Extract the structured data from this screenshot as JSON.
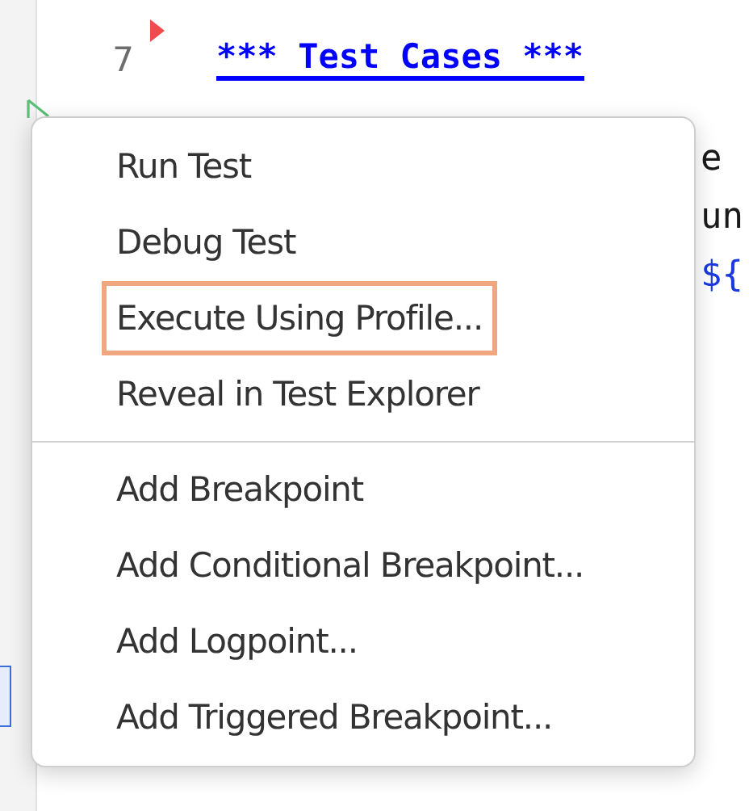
{
  "editor": {
    "line_number": "7",
    "heading": "*** Test Cases ***",
    "breakpoint_marker": true,
    "run_test_button": true,
    "fragments": [
      "e",
      "un",
      "${"
    ]
  },
  "context_menu": {
    "groups": [
      [
        {
          "label": "Run Test",
          "highlighted": false
        },
        {
          "label": "Debug Test",
          "highlighted": false
        },
        {
          "label": "Execute Using Profile...",
          "highlighted": true
        },
        {
          "label": "Reveal in Test Explorer",
          "highlighted": false
        }
      ],
      [
        {
          "label": "Add Breakpoint",
          "highlighted": false
        },
        {
          "label": "Add Conditional Breakpoint...",
          "highlighted": false
        },
        {
          "label": "Add Logpoint...",
          "highlighted": false
        },
        {
          "label": "Add Triggered Breakpoint...",
          "highlighted": false
        }
      ]
    ]
  }
}
